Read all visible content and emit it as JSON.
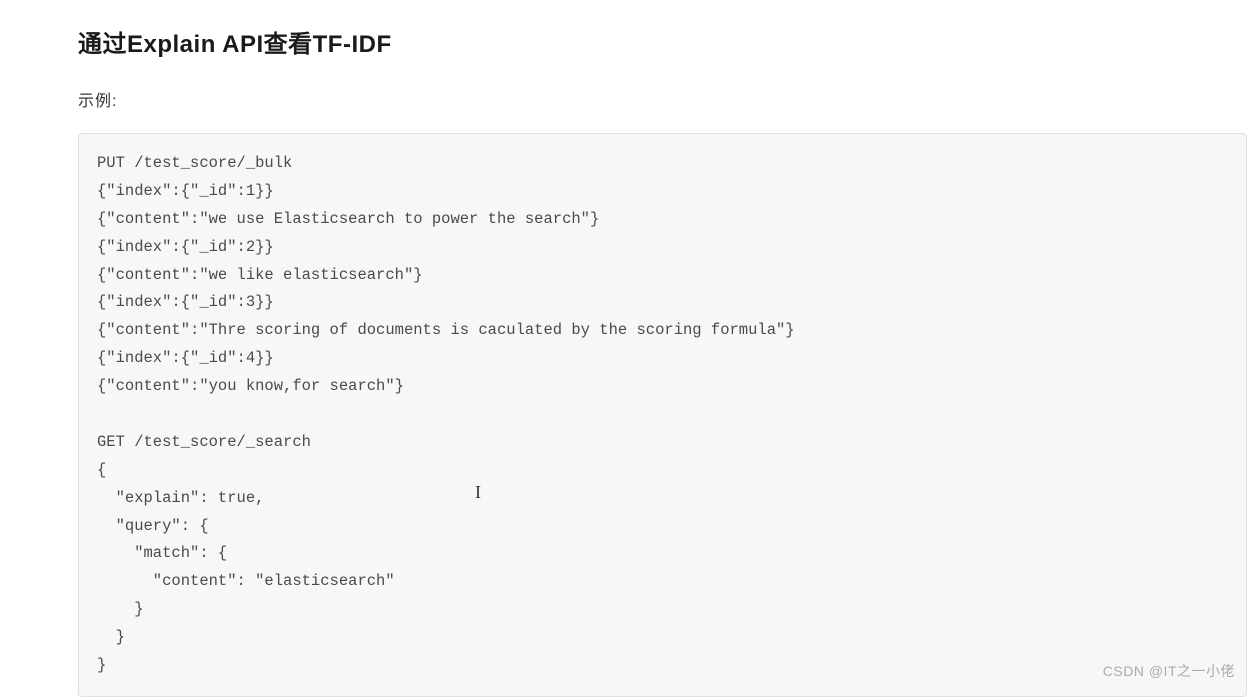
{
  "heading": "通过Explain API查看TF-IDF",
  "subtext": "示例:",
  "code": "PUT /test_score/_bulk\n{\"index\":{\"_id\":1}}\n{\"content\":\"we use Elasticsearch to power the search\"}\n{\"index\":{\"_id\":2}}\n{\"content\":\"we like elasticsearch\"}\n{\"index\":{\"_id\":3}}\n{\"content\":\"Thre scoring of documents is caculated by the scoring formula\"}\n{\"index\":{\"_id\":4}}\n{\"content\":\"you know,for search\"}\n\nGET /test_score/_search\n{\n  \"explain\": true,\n  \"query\": {\n    \"match\": {\n      \"content\": \"elasticsearch\"\n    }\n  }\n}",
  "watermark": "CSDN @IT之一小佬",
  "cursor": "I"
}
